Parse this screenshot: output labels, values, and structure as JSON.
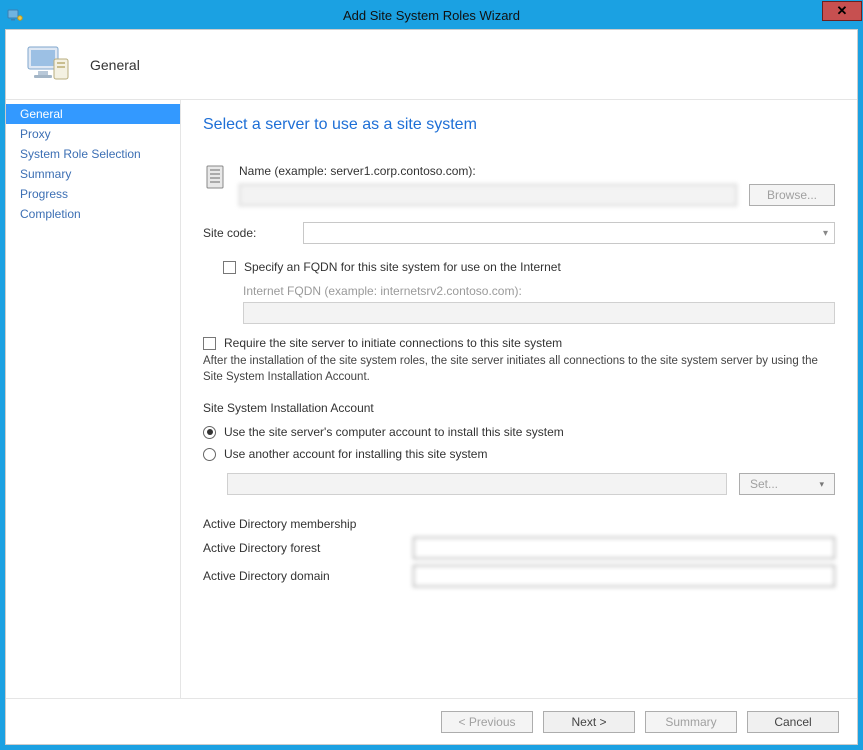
{
  "titlebar": {
    "title": "Add Site System Roles Wizard"
  },
  "header": {
    "page_name": "General"
  },
  "sidebar": {
    "items": [
      {
        "label": "General",
        "active": true
      },
      {
        "label": "Proxy"
      },
      {
        "label": "System Role Selection"
      },
      {
        "label": "Summary"
      },
      {
        "label": "Progress"
      },
      {
        "label": "Completion"
      }
    ]
  },
  "content": {
    "heading": "Select a server to use as a site system",
    "name_label": "Name (example: server1.corp.contoso.com):",
    "name_value": "",
    "browse_label": "Browse...",
    "site_code_label": "Site code:",
    "site_code_value": "",
    "specify_fqdn_label": "Specify an FQDN for this site system for use on the Internet",
    "internet_fqdn_label": "Internet FQDN (example: internetsrv2.contoso.com):",
    "internet_fqdn_value": "",
    "require_initiate_label": "Require the site server to initiate connections to this site system",
    "help_text": "After the  installation of the site system roles, the site server initiates all connections to the site system server by using the Site System Installation Account.",
    "install_account_title": "Site System Installation Account",
    "radio_computer_account": "Use the site server's computer account to install this site system",
    "radio_other_account": "Use another account for installing this site system",
    "set_button": "Set...",
    "ad_title": "Active Directory membership",
    "ad_forest_label": "Active Directory forest",
    "ad_forest_value": "",
    "ad_domain_label": "Active Directory domain",
    "ad_domain_value": ""
  },
  "footer": {
    "previous": "< Previous",
    "next": "Next >",
    "summary": "Summary",
    "cancel": "Cancel"
  }
}
